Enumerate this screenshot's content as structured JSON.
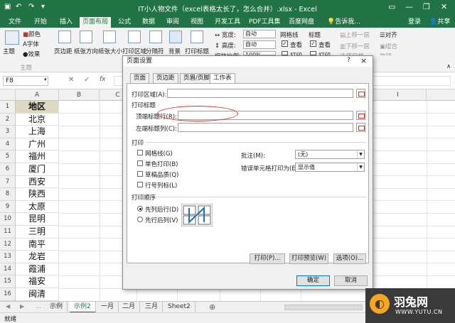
{
  "window": {
    "title": "IT小人物文件（excel表格太长了，怎么合并）.xlsx - Excel",
    "login": "登录",
    "share": "共享"
  },
  "ribbon_tabs": [
    "文件",
    "开始",
    "插入",
    "页面布局",
    "公式",
    "数据",
    "审阅",
    "视图",
    "开发工具",
    "PDF工具集",
    "百度网盘"
  ],
  "tell_me": "告诉我...",
  "ribbon": {
    "theme_group": {
      "themes": "主题",
      "colors": "颜色",
      "fonts": "字体",
      "effects": "效果",
      "label": "主题"
    },
    "page_setup": [
      "页边距",
      "纸张方向",
      "纸张大小",
      "打印区域",
      "分隔符",
      "背景",
      "打印标题"
    ],
    "scale": {
      "width_label": "宽度:",
      "width_value": "自动",
      "height_label": "高度:",
      "height_value": "自动",
      "scale_label": "缩放比例:",
      "scale_value": "100%"
    },
    "gridlines": {
      "title": "网格线",
      "view": "查看",
      "print": "打印"
    },
    "headings": {
      "title": "标题",
      "view": "查看",
      "print": "打印"
    },
    "arrange": {
      "bring_forward": "上移一层",
      "send_backward": "下移一层",
      "selection_pane": "选择窗格",
      "align": "对齐",
      "group": "组合",
      "rotate": "旋转"
    }
  },
  "namebox": "F8",
  "fx": "fx",
  "columns": [
    "A",
    "B",
    "C",
    "D",
    "E",
    "F",
    "G",
    "H",
    "I"
  ],
  "rows": [
    {
      "n": "1",
      "a": "地区"
    },
    {
      "n": "2",
      "a": "北京"
    },
    {
      "n": "3",
      "a": "上海"
    },
    {
      "n": "4",
      "a": "广州"
    },
    {
      "n": "5",
      "a": "福州"
    },
    {
      "n": "6",
      "a": "厦门"
    },
    {
      "n": "7",
      "a": "西安"
    },
    {
      "n": "8",
      "a": "陕西"
    },
    {
      "n": "9",
      "a": "太原"
    },
    {
      "n": "10",
      "a": "昆明"
    },
    {
      "n": "11",
      "a": "三明"
    },
    {
      "n": "12",
      "a": "南平"
    },
    {
      "n": "13",
      "a": "龙岩"
    },
    {
      "n": "14",
      "a": "霞浦"
    },
    {
      "n": "15",
      "a": "福安"
    },
    {
      "n": "16",
      "a": "闽清"
    },
    {
      "n": "17",
      "a": "福清"
    }
  ],
  "sheet_tabs": [
    "示例",
    "示例2",
    "一月",
    "二月",
    "三月",
    "Sheet2"
  ],
  "active_sheet": "示例2",
  "status": "就绪",
  "dialog": {
    "title": "页面设置",
    "help": "?",
    "close": "×",
    "tabs": [
      "页面",
      "页边距",
      "页眉/页脚",
      "工作表"
    ],
    "print_area_label": "打印区域(A):",
    "print_titles_label": "打印标题",
    "top_rows_label": "顶端标题行(R):",
    "left_cols_label": "左端标题列(C):",
    "print_section": "打印",
    "gridlines": "网格线(G)",
    "bw": "单色打印(B)",
    "draft": "草稿品质(Q)",
    "rowcol": "行号列标(L)",
    "comments_label": "批注(M):",
    "comments_value": "(无)",
    "errors_label": "错误单元格打印为(E):",
    "errors_value": "显示值",
    "order_section": "打印顺序",
    "down_then_over": "先列后行(D)",
    "over_then_down": "先行后列(V)",
    "btn_print": "打印(P)...",
    "btn_preview": "打印预览(W)",
    "btn_options": "选项(O)...",
    "btn_ok": "确定",
    "btn_cancel": "取消"
  },
  "watermark": {
    "brand": "羽兔网",
    "url": "WWW.YUTU.CN"
  },
  "colors": {
    "excel_green": "#217346",
    "highlight_circle": "#d9342b",
    "watermark_bg": "#3a3a3a",
    "watermark_accent": "#f5a623"
  }
}
